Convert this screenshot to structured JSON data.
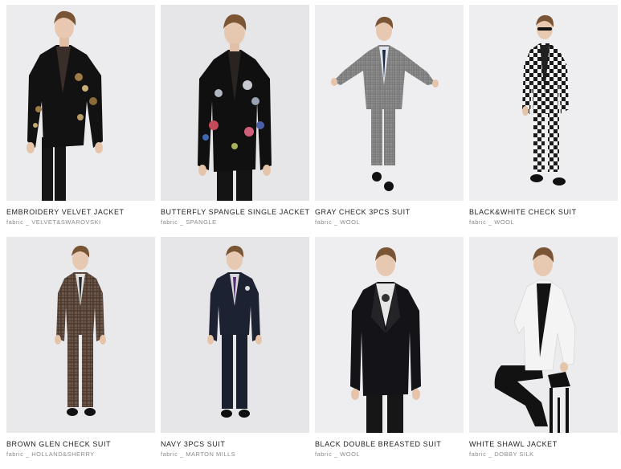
{
  "products": [
    {
      "name": "EMBROIDERY VELVET JACKET",
      "fabric_label": "fabric _",
      "fabric": "VELVET&SWAROVSKI"
    },
    {
      "name": "BUTTERFLY SPANGLE SINGLE JACKET",
      "fabric_label": "fabric _",
      "fabric": "SPANGLE"
    },
    {
      "name": "GRAY CHECK 3PCS SUIT",
      "fabric_label": "fabric _",
      "fabric": "WOOL"
    },
    {
      "name": "BLACK&WHITE CHECK SUIT",
      "fabric_label": "fabric _",
      "fabric": "WOOL"
    },
    {
      "name": "BROWN GLEN CHECK SUIT",
      "fabric_label": "fabric _",
      "fabric": "HOLLAND&SHERRY"
    },
    {
      "name": "NAVY 3PCS SUIT",
      "fabric_label": "fabric _",
      "fabric": "MARTON MILLS"
    },
    {
      "name": "BLACK DOUBLE BREASTED SUIT",
      "fabric_label": "fabric _",
      "fabric": "WOOL"
    },
    {
      "name": "WHITE SHAWL JACKET",
      "fabric_label": "fabric _",
      "fabric": "DOBBY SILK"
    }
  ],
  "colors": {
    "photo_bg": "#e9e9eb",
    "name_text": "#222222",
    "fabric_text": "#8a8a8a"
  }
}
